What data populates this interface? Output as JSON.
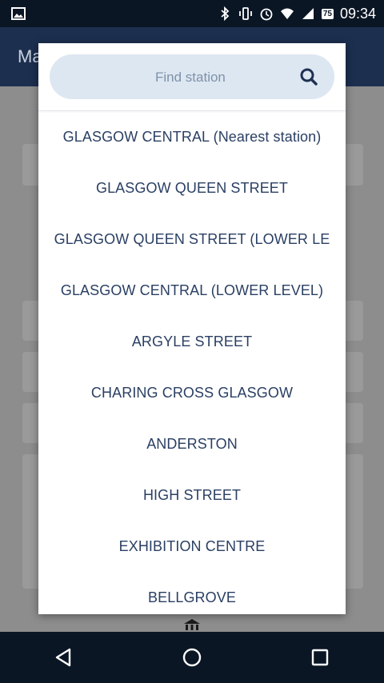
{
  "status_bar": {
    "time": "09:34",
    "battery_level": "75",
    "icons": [
      "image-icon",
      "bluetooth-icon",
      "vibrate-icon",
      "alarm-icon",
      "wifi-icon",
      "signal-icon",
      "battery-icon"
    ]
  },
  "app_bar": {
    "title": "Ma"
  },
  "station_picker": {
    "search": {
      "placeholder": "Find station",
      "value": ""
    },
    "stations": [
      "GLASGOW CENTRAL (Nearest station)",
      "GLASGOW QUEEN STREET",
      "GLASGOW QUEEN STREET (LOWER LE",
      "GLASGOW CENTRAL (LOWER LEVEL)",
      "ARGYLE STREET",
      "CHARING CROSS GLASGOW",
      "ANDERSTON",
      "HIGH STREET",
      "EXHIBITION CENTRE",
      "BELLGROVE"
    ]
  },
  "colors": {
    "accent": "#2a3f63",
    "search_bg": "#dde7f1",
    "status_bar": "#0b1625",
    "app_bar": "#1c2f4f"
  },
  "nav_bar": {
    "buttons": [
      "back-icon",
      "home-icon",
      "recents-icon"
    ]
  }
}
